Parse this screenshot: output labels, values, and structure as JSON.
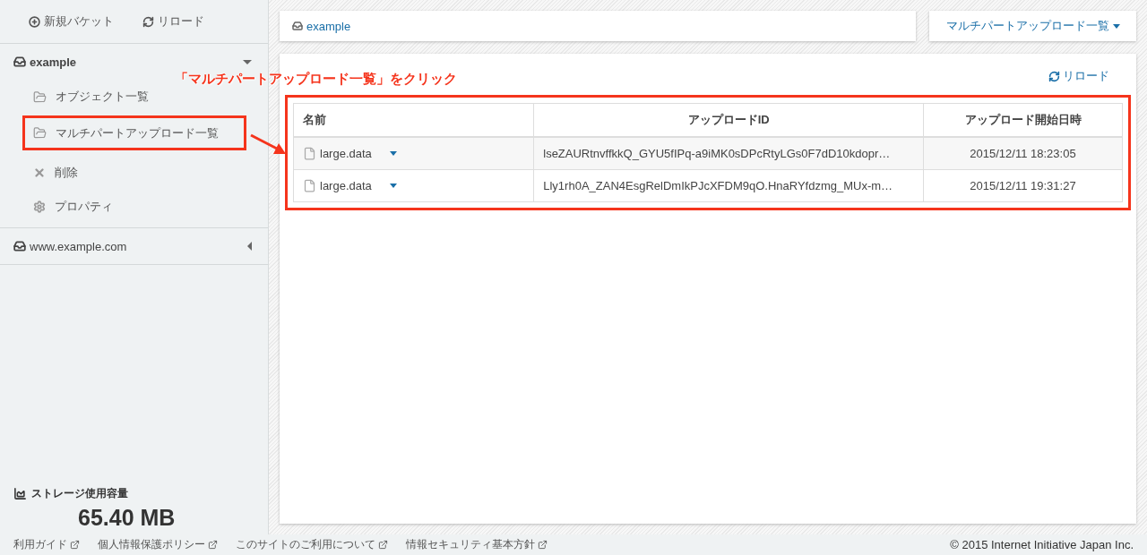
{
  "sidebar": {
    "toolbar": [
      {
        "kind": "add",
        "label": "新規バケット"
      },
      {
        "kind": "reload",
        "label": "リロード"
      }
    ],
    "buckets": [
      {
        "name": "example",
        "expanded": true,
        "items": [
          {
            "kind": "folder",
            "label": "オブジェクト一覧",
            "highlighted": false
          },
          {
            "kind": "folder",
            "label": "マルチパートアップロード一覧",
            "highlighted": true
          },
          {
            "kind": "delete",
            "label": "削除",
            "highlighted": false
          },
          {
            "kind": "settings",
            "label": "プロパティ",
            "highlighted": false
          }
        ]
      },
      {
        "name": "www.example.com",
        "expanded": false
      }
    ],
    "storage": {
      "label": "ストレージ使用容量",
      "value": "65.40 MB"
    }
  },
  "breadcrumb": "example",
  "view_menu": "マルチパートアップロード一覧",
  "callout": "「マルチパートアップロード一覧」をクリック",
  "reload": "リロード",
  "table": {
    "highlighted": true,
    "columns": [
      "名前",
      "アップロードID",
      "アップロード開始日時"
    ],
    "rows": [
      [
        "large.data",
        "lseZAURtnvffkkQ_GYU5fIPq-a9iMK0sDPcRtyLGs0F7dD10kdopr…",
        "2015/12/11 18:23:05"
      ],
      [
        "large.data",
        "Lly1rh0A_ZAN4EsgRelDmIkPJcXFDM9qO.HnaRYfdzmg_MUx-m…",
        "2015/12/11 19:31:27"
      ]
    ]
  },
  "footer": {
    "links": [
      "利用ガイド",
      "個人情報保護ポリシー",
      "このサイトのご利用について",
      "情報セキュリティ基本方針"
    ],
    "copyright": "© 2015 Internet Initiative Japan Inc."
  }
}
